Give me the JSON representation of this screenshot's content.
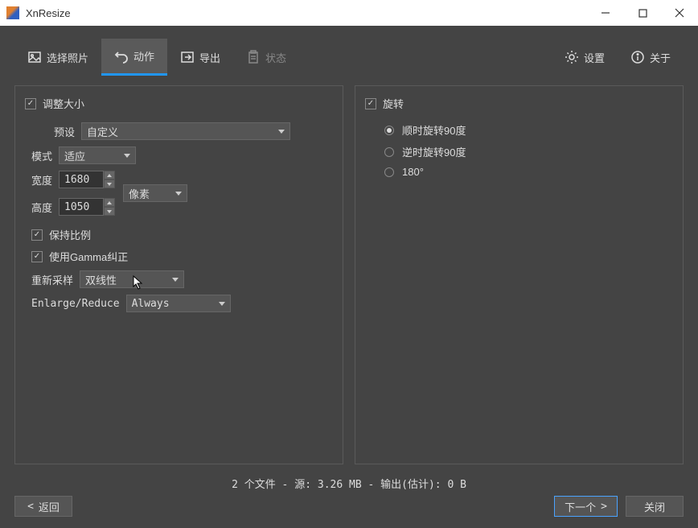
{
  "window": {
    "title": "XnResize"
  },
  "tabs": {
    "select": "选择照片",
    "action": "动作",
    "export": "导出",
    "status": "状态",
    "settings": "设置",
    "about": "关于"
  },
  "resize": {
    "title": "调整大小",
    "checked": true,
    "presetLabel": "预设",
    "presetValue": "自定义",
    "modeLabel": "模式",
    "modeValue": "适应",
    "widthLabel": "宽度",
    "widthValue": "1680",
    "heightLabel": "高度",
    "heightValue": "1050",
    "unitValue": "像素",
    "keepRatioLabel": "保持比例",
    "keepRatioChecked": true,
    "gammaLabel": "使用Gamma纠正",
    "gammaChecked": true,
    "resampleLabel": "重新采样",
    "resampleValue": "双线性",
    "enlargeLabel": "Enlarge/Reduce",
    "enlargeValue": "Always"
  },
  "rotate": {
    "title": "旋转",
    "checked": true,
    "cw90": "顺时旋转90度",
    "ccw90": "逆时旋转90度",
    "r180": "180°",
    "selected": "cw90"
  },
  "status": "2 个文件 - 源: 3.26 MB - 输出(估计): 0 B",
  "footer": {
    "back": "返回",
    "next": "下一个",
    "close": "关闭"
  }
}
